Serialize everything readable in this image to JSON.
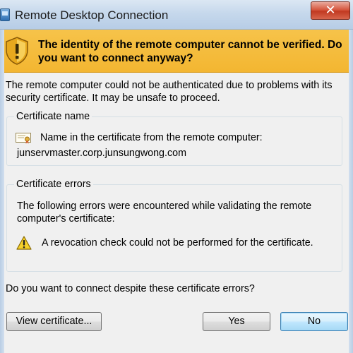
{
  "window": {
    "title": "Remote Desktop Connection",
    "close_glyph": "✕"
  },
  "banner": {
    "message": "The identity of the remote computer cannot be verified. Do you want to connect anyway?",
    "icon": "warning-shield-icon",
    "color": "#f3b631"
  },
  "intro": "The remote computer could not be authenticated due to problems with its security certificate. It may be unsafe to proceed.",
  "certificate_name": {
    "title": "Certificate name",
    "label": "Name in the certificate from the remote computer:",
    "value": "junservmaster.corp.junsungwong.com"
  },
  "certificate_errors": {
    "title": "Certificate errors",
    "intro": "The following errors were encountered while validating the remote computer's certificate:",
    "items": [
      "A revocation check could not be performed for the certificate."
    ]
  },
  "question": "Do you want to connect despite these certificate errors?",
  "buttons": {
    "view_certificate": "View certificate...",
    "yes": "Yes",
    "no": "No"
  }
}
